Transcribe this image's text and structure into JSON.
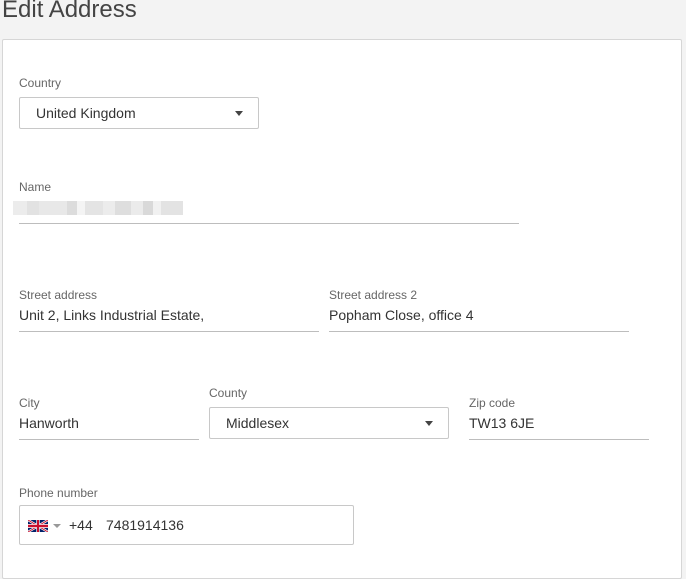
{
  "page": {
    "title": "Edit Address"
  },
  "country": {
    "label": "Country",
    "value": "United Kingdom"
  },
  "name": {
    "label": "Name"
  },
  "street_address": {
    "label": "Street address",
    "value": "Unit 2, Links Industrial Estate,"
  },
  "street_address_2": {
    "label": "Street address 2",
    "value": "Popham Close, office 4"
  },
  "city": {
    "label": "City",
    "value": "Hanworth"
  },
  "county": {
    "label": "County",
    "value": "Middlesex"
  },
  "zip": {
    "label": "Zip code",
    "value": "TW13 6JE"
  },
  "phone": {
    "label": "Phone number",
    "flag_icon": "uk-flag-icon",
    "dial_code": "+44",
    "number": "7481914136"
  },
  "colors": {
    "background": "#f3f3f3",
    "card": "#ffffff",
    "border": "#c8c8c8",
    "underline": "#bdbdbd"
  }
}
